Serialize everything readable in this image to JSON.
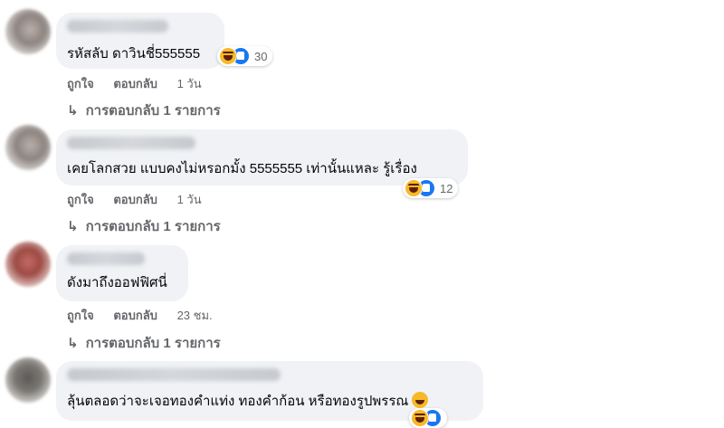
{
  "comments": [
    {
      "text": "รหัสลับ ดาวินชี่555555",
      "reaction_count": "30",
      "actions": {
        "like": "ถูกใจ",
        "reply": "ตอบกลับ",
        "time": "1 วัน"
      },
      "replies": "การตอบกลับ 1 รายการ"
    },
    {
      "text": "เคยโลกสวย แบบคงไม่หรอกมั้ง 5555555 เท่านั้นแหละ รู้เรื่อง",
      "reaction_count": "12",
      "actions": {
        "like": "ถูกใจ",
        "reply": "ตอบกลับ",
        "time": "1 วัน"
      },
      "replies": "การตอบกลับ 1 รายการ"
    },
    {
      "text": "ดังมาถึงออฟฟิศนี่",
      "actions": {
        "like": "ถูกใจ",
        "reply": "ตอบกลับ",
        "time": "23 ชม."
      },
      "replies": "การตอบกลับ 1 รายการ"
    },
    {
      "text": "ลุ้นตลอดว่าจะเจอทองคำแท่ง ทองคำก้อน หรือทองรูปพรรณ"
    }
  ],
  "reply_arrow": "↳",
  "colors": {
    "bubble": "#f0f2f5",
    "meta": "#65676b",
    "like_blue": "#1877f2",
    "haha_yellow": "#f7b928"
  },
  "icons": [
    "haha-reaction-icon",
    "like-reaction-icon",
    "reply-arrow-icon",
    "grinning-emoji-icon"
  ]
}
